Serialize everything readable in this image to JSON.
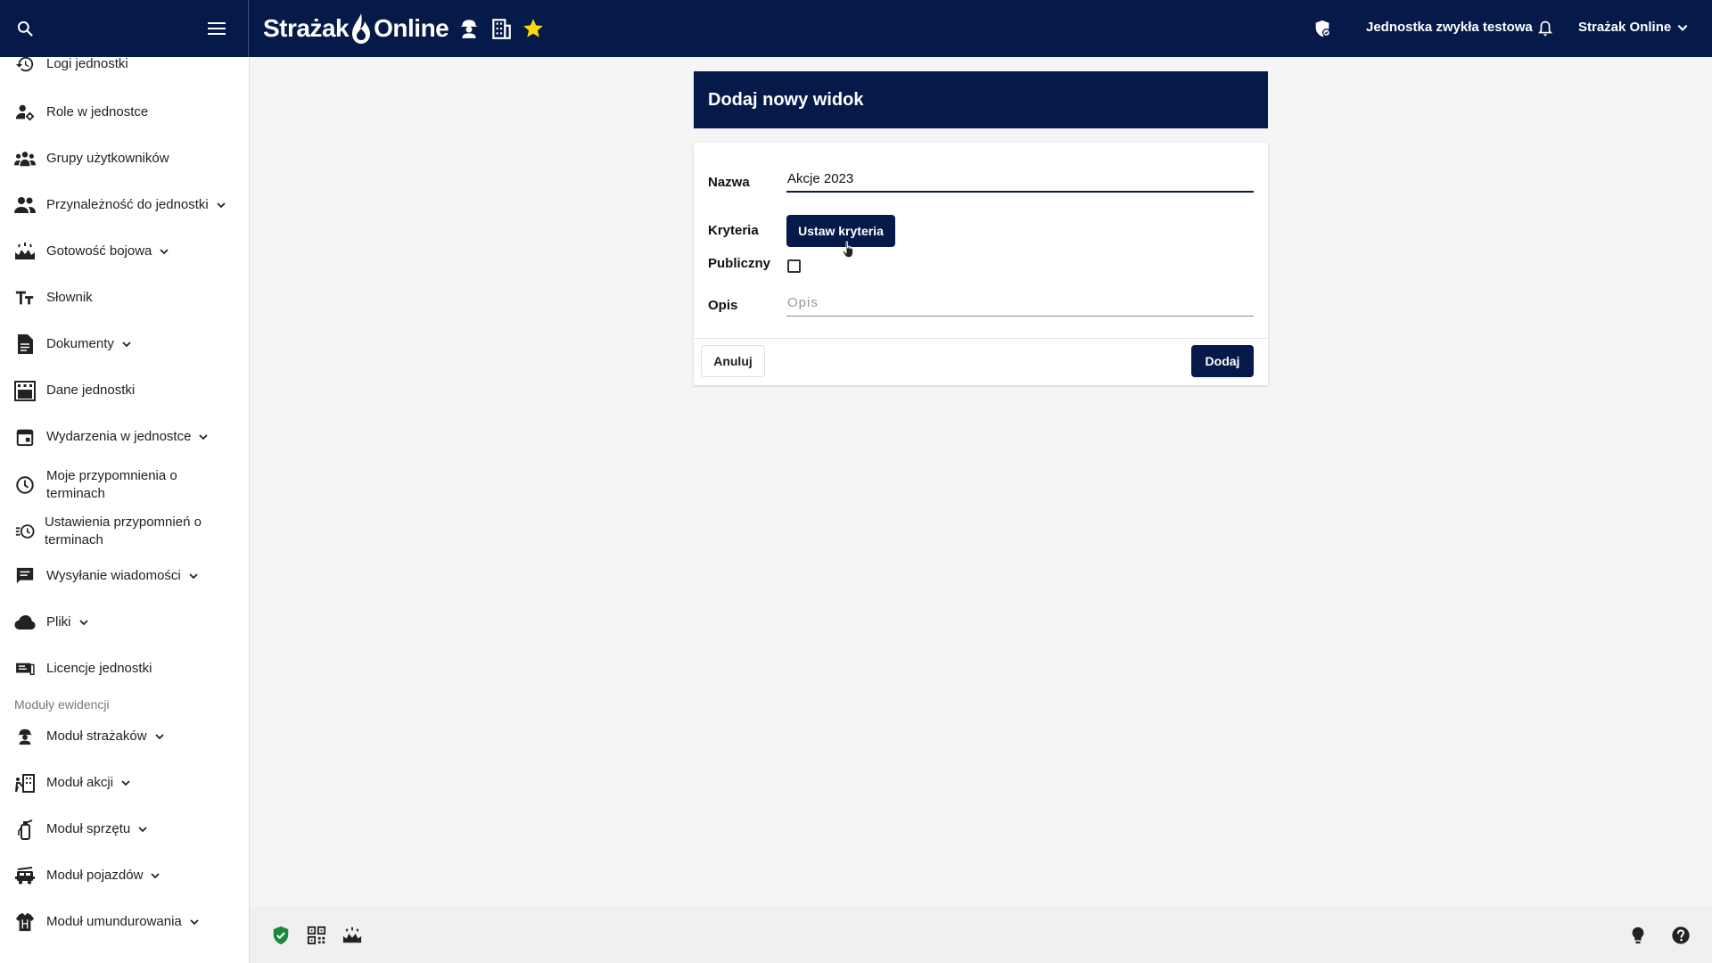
{
  "header": {
    "brand_left": "Strażak",
    "brand_right": "Online",
    "unit_name": "Jednostka zwykła testowa",
    "account_label": "Strażak Online",
    "colors": {
      "primary": "#061a4a",
      "favorite": "#f5d90a",
      "shield_ok": "#1a8a3a"
    }
  },
  "sidebar": {
    "items": [
      {
        "label": "Logi jednostki",
        "icon": "history-icon"
      },
      {
        "label": "Role w jednostce",
        "icon": "user-gear-icon"
      },
      {
        "label": "Grupy użytkowników",
        "icon": "groups-icon"
      },
      {
        "label": "Przynależność do jednostki",
        "icon": "people-icon"
      },
      {
        "label": "Gotowość bojowa",
        "icon": "readiness-icon"
      },
      {
        "label": "Słownik",
        "icon": "text-fields-icon"
      },
      {
        "label": "Dokumenty",
        "icon": "document-icon"
      },
      {
        "label": "Dane jednostki",
        "icon": "fire-station-icon"
      },
      {
        "label": "Wydarzenia w jednostce",
        "icon": "calendar-icon"
      },
      {
        "label": "Moje przypomnienia o terminach",
        "icon": "clock-icon"
      },
      {
        "label": "Ustawienia przypomnień o terminach",
        "icon": "alarm-settings-icon"
      },
      {
        "label": "Wysyłanie wiadomości",
        "icon": "message-icon"
      },
      {
        "label": "Pliki",
        "icon": "cloud-icon"
      },
      {
        "label": "Licencje jednostki",
        "icon": "license-icon"
      }
    ],
    "section_label": "Moduły ewidencji",
    "modules": [
      {
        "label": "Moduł strażaków",
        "icon": "firefighter-icon"
      },
      {
        "label": "Moduł akcji",
        "icon": "action-icon"
      },
      {
        "label": "Moduł sprzętu",
        "icon": "extinguisher-icon"
      },
      {
        "label": "Moduł pojazdów",
        "icon": "fire-truck-icon"
      },
      {
        "label": "Moduł umundurowania",
        "icon": "uniform-icon"
      }
    ]
  },
  "form": {
    "title": "Dodaj nowy widok",
    "name_label": "Nazwa",
    "name_value": "Akcje 2023",
    "criteria_label": "Kryteria",
    "criteria_button": "Ustaw kryteria",
    "public_label": "Publiczny",
    "public_checked": false,
    "description_label": "Opis",
    "description_placeholder": "Opis",
    "cancel_button": "Anuluj",
    "add_button": "Dodaj"
  }
}
